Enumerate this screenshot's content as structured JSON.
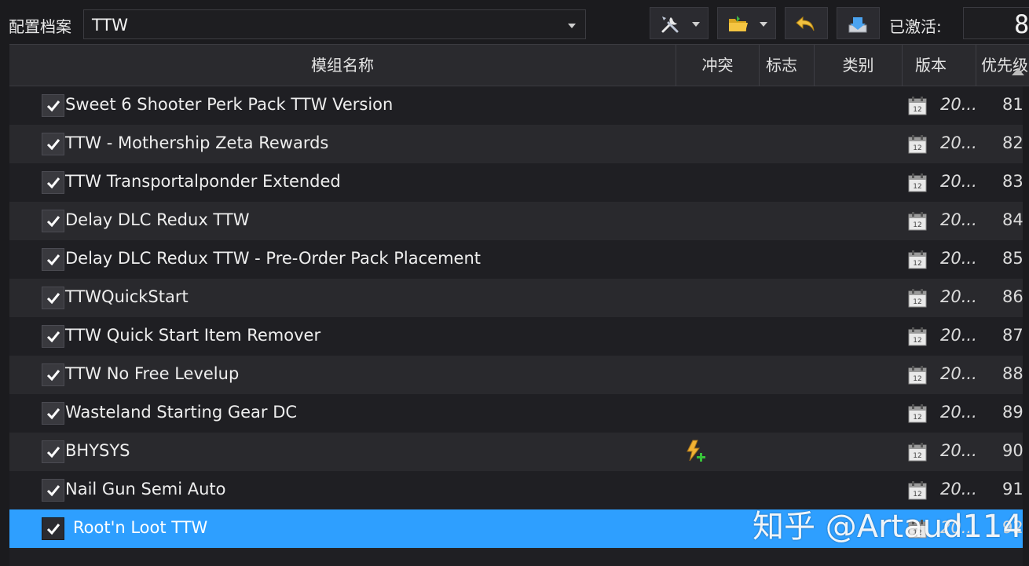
{
  "profile": {
    "label": "配置档案",
    "selected": "TTW"
  },
  "toolbar": {
    "tools_icon": "tools-icon",
    "folder_icon": "folder-open-icon",
    "undo_icon": "undo-icon",
    "export_icon": "export-icon",
    "active_label": "已激活:",
    "active_count": "8"
  },
  "table": {
    "columns": [
      "模组名称",
      "冲突",
      "标志",
      "类别",
      "版本",
      "优先级"
    ],
    "rows": [
      {
        "name": "Sweet 6 Shooter Perk Pack TTW Version",
        "version": "20...",
        "priority": "81",
        "checked": true,
        "conflict": false,
        "selected": false
      },
      {
        "name": "TTW - Mothership Zeta Rewards",
        "version": "20...",
        "priority": "82",
        "checked": true,
        "conflict": false,
        "selected": false
      },
      {
        "name": "TTW Transportalponder Extended",
        "version": "20...",
        "priority": "83",
        "checked": true,
        "conflict": false,
        "selected": false
      },
      {
        "name": "Delay DLC Redux TTW",
        "version": "20...",
        "priority": "84",
        "checked": true,
        "conflict": false,
        "selected": false
      },
      {
        "name": "Delay DLC Redux TTW - Pre-Order Pack Placement",
        "version": "20...",
        "priority": "85",
        "checked": true,
        "conflict": false,
        "selected": false
      },
      {
        "name": "TTWQuickStart",
        "version": "20...",
        "priority": "86",
        "checked": true,
        "conflict": false,
        "selected": false
      },
      {
        "name": "TTW Quick Start Item Remover",
        "version": "20...",
        "priority": "87",
        "checked": true,
        "conflict": false,
        "selected": false
      },
      {
        "name": "TTW No Free Levelup",
        "version": "20...",
        "priority": "88",
        "checked": true,
        "conflict": false,
        "selected": false
      },
      {
        "name": "Wasteland Starting Gear DC",
        "version": "20...",
        "priority": "89",
        "checked": true,
        "conflict": false,
        "selected": false
      },
      {
        "name": "BHYSYS",
        "version": "20...",
        "priority": "90",
        "checked": true,
        "conflict": true,
        "selected": false
      },
      {
        "name": "Nail Gun Semi Auto",
        "version": "20...",
        "priority": "91",
        "checked": true,
        "conflict": false,
        "selected": false
      },
      {
        "name": "Root'n Loot TTW",
        "version": "20...",
        "priority": "92",
        "checked": true,
        "conflict": false,
        "selected": true
      }
    ]
  },
  "watermark": "知乎 @Artaud114",
  "colors": {
    "selected_row": "#2e9fff",
    "row_odd": "#1f1f23",
    "row_even": "#29292d",
    "header": "#2a2a2e"
  }
}
